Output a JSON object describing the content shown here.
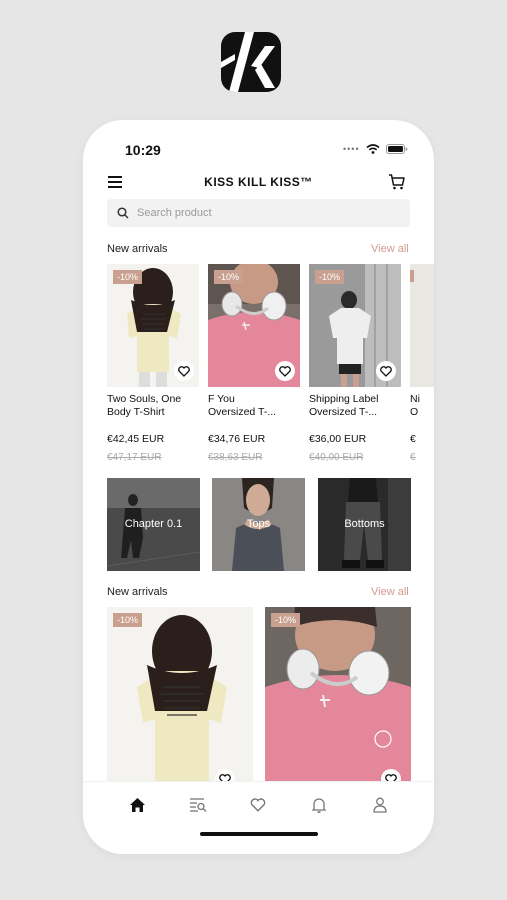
{
  "status": {
    "time": "10:29"
  },
  "header": {
    "brand": "KISS KILL KISS™"
  },
  "search": {
    "placeholder": "Search product"
  },
  "sections": [
    {
      "title": "New arrivals",
      "view_all": "View all"
    },
    {
      "title": "New arrivals",
      "view_all": "View all"
    }
  ],
  "products": [
    {
      "name_line1": "Two Souls, One",
      "name_line2": "Body T-Shirt",
      "price": "€42,45 EUR",
      "old_price": "€47,17 EUR",
      "discount": "-10%"
    },
    {
      "name_line1": "F You",
      "name_line2": "Oversized T-...",
      "price": "€34,76 EUR",
      "old_price": "€38,63 EUR",
      "discount": "-10%"
    },
    {
      "name_line1": "Shipping Label",
      "name_line2": "Oversized T-...",
      "price": "€36,00 EUR",
      "old_price": "€40,00 EUR",
      "discount": "-10%"
    },
    {
      "name_line1": "Ni",
      "name_line2": "O",
      "price": "€",
      "old_price": "€",
      "discount": ""
    }
  ],
  "categories": [
    {
      "label": "Chapter 0.1"
    },
    {
      "label": "Tops"
    },
    {
      "label": "Bottoms"
    }
  ],
  "featured": [
    {
      "discount": "-10%"
    },
    {
      "discount": "-10%"
    }
  ],
  "tabs": [
    "home-icon",
    "browse-icon",
    "heart-icon",
    "bell-icon",
    "user-icon"
  ],
  "colors": {
    "accent": "#d29a90",
    "badge": "#c9a08f",
    "dark": "#111111"
  }
}
